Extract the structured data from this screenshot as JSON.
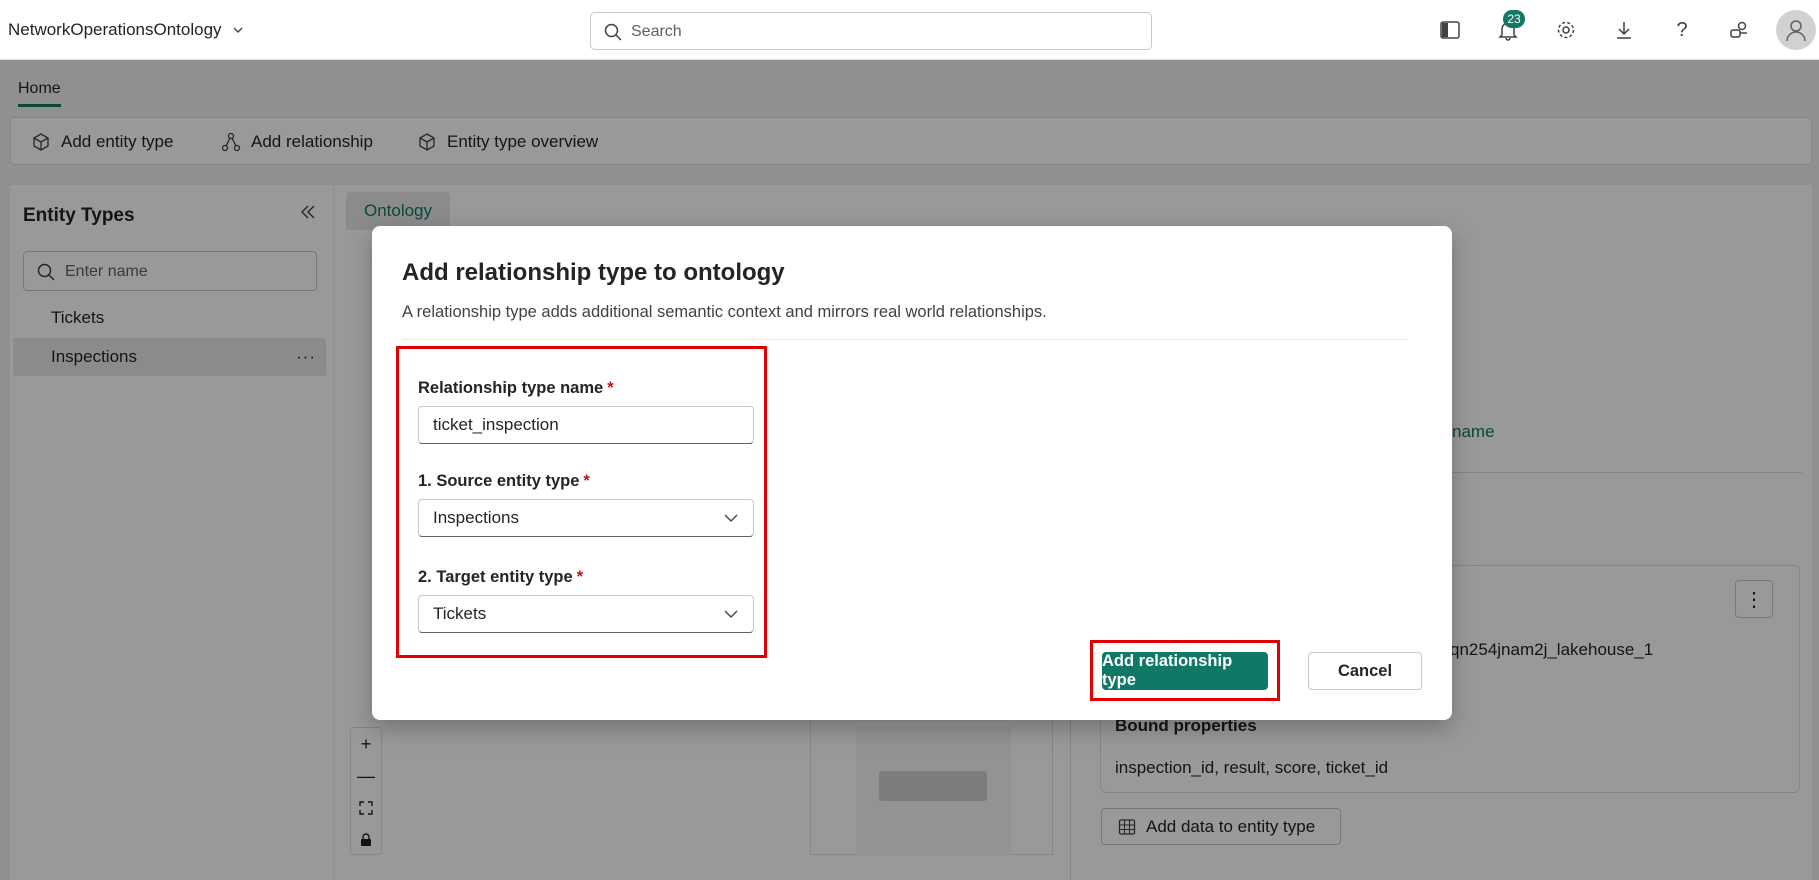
{
  "topbar": {
    "app_name": "NetworkOperationsOntology",
    "search_placeholder": "Search",
    "notification_count": "23"
  },
  "home_tab": "Home",
  "ribbon": {
    "add_entity_type": "Add entity type",
    "add_relationship": "Add relationship",
    "entity_type_overview": "Entity type overview"
  },
  "left_panel": {
    "title": "Entity Types",
    "search_placeholder": "Enter name",
    "items": [
      {
        "label": "Tickets"
      },
      {
        "label": "Inspections"
      }
    ]
  },
  "main": {
    "tab": "Ontology",
    "link_fragment": "name",
    "lakehouse_fragment": "qn254jnam2j_lakehouse_1",
    "bound_properties_label": "Bound properties",
    "bound_properties_value": "inspection_id, result, score, ticket_id",
    "add_data_button": "Add data to entity type"
  },
  "dialog": {
    "title": "Add relationship type to ontology",
    "description": "A relationship type adds additional semantic context and mirrors real world relationships.",
    "name_label": "Relationship type name",
    "name_value": "ticket_inspection",
    "source_label": "1. Source entity type",
    "source_value": "Inspections",
    "target_label": "2. Target entity type",
    "target_value": "Tickets",
    "required_marker": "*",
    "primary_button": "Add relationship type",
    "cancel_button": "Cancel"
  },
  "colors": {
    "accent": "#117865",
    "highlight": "#e00000",
    "required": "#c50f1f"
  }
}
